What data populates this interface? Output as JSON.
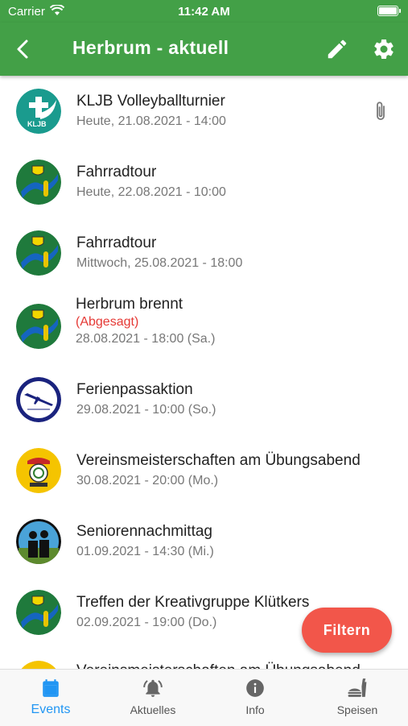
{
  "status": {
    "carrier": "Carrier",
    "time": "11:42 AM",
    "battery": 0.9
  },
  "appbar": {
    "title": "Herbrum - aktuell"
  },
  "events": [
    {
      "title": "KLJB Volleyballturnier",
      "subtitle": "Heute, 21.08.2021 - 14:00"
    },
    {
      "title": "Fahrradtour",
      "subtitle": "Heute, 22.08.2021 - 10:00"
    },
    {
      "title": "Fahrradtour",
      "subtitle": "Mittwoch, 25.08.2021 - 18:00"
    },
    {
      "title": "Herbrum brennt",
      "cancelled": "(Abgesagt)",
      "subtitle": "28.08.2021 - 18:00 (Sa.)"
    },
    {
      "title": "Ferienpassaktion",
      "subtitle": "29.08.2021 - 10:00 (So.)"
    },
    {
      "title": "Vereinsmeisterschaften am Übungsabend",
      "subtitle": "30.08.2021 - 20:00 (Mo.)"
    },
    {
      "title": "Seniorennachmittag",
      "subtitle": "01.09.2021 - 14:30 (Mi.)"
    },
    {
      "title": "Treffen der Kreativgruppe Klütkers",
      "subtitle": "02.09.2021 - 19:00 (Do.)"
    },
    {
      "title": "Vereinsmeisterschaften am Übungsabend"
    }
  ],
  "fab": {
    "label": "Filtern"
  },
  "tabs": {
    "events": "Events",
    "aktuelles": "Aktuelles",
    "info": "Info",
    "speisen": "Speisen"
  },
  "colors": {
    "primary": "#43a047",
    "accent": "#f2564a",
    "active_tab": "#2196f3",
    "cancelled": "#e53935"
  }
}
